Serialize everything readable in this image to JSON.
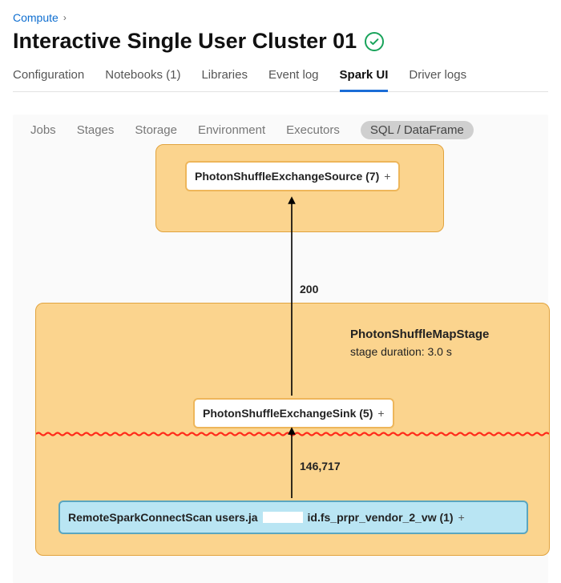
{
  "breadcrumb": {
    "root": "Compute"
  },
  "cluster": {
    "title": "Interactive Single User Cluster 01",
    "status": "running"
  },
  "tabs_primary": {
    "configuration": "Configuration",
    "notebooks": "Notebooks (1)",
    "libraries": "Libraries",
    "event_log": "Event log",
    "spark_ui": "Spark UI",
    "driver_logs": "Driver logs",
    "active": "spark_ui"
  },
  "tabs_secondary": {
    "jobs": "Jobs",
    "stages": "Stages",
    "storage": "Storage",
    "environment": "Environment",
    "executors": "Executors",
    "sql": "SQL / DataFrame",
    "active": "sql"
  },
  "dag": {
    "stage_upper": {
      "source_op": "PhotonShuffleExchangeSource (7)"
    },
    "stage_lower": {
      "title": "PhotonShuffleMapStage",
      "duration_label": "stage duration: 3.0 s",
      "sink_op": "PhotonShuffleExchangeSink (5)",
      "scan_op_prefix": "RemoteSparkConnectScan users.ja",
      "scan_op_suffix": "id.fs_prpr_vendor_2_vw (1)"
    },
    "edges": {
      "upper": "200",
      "lower": "146,717"
    }
  }
}
